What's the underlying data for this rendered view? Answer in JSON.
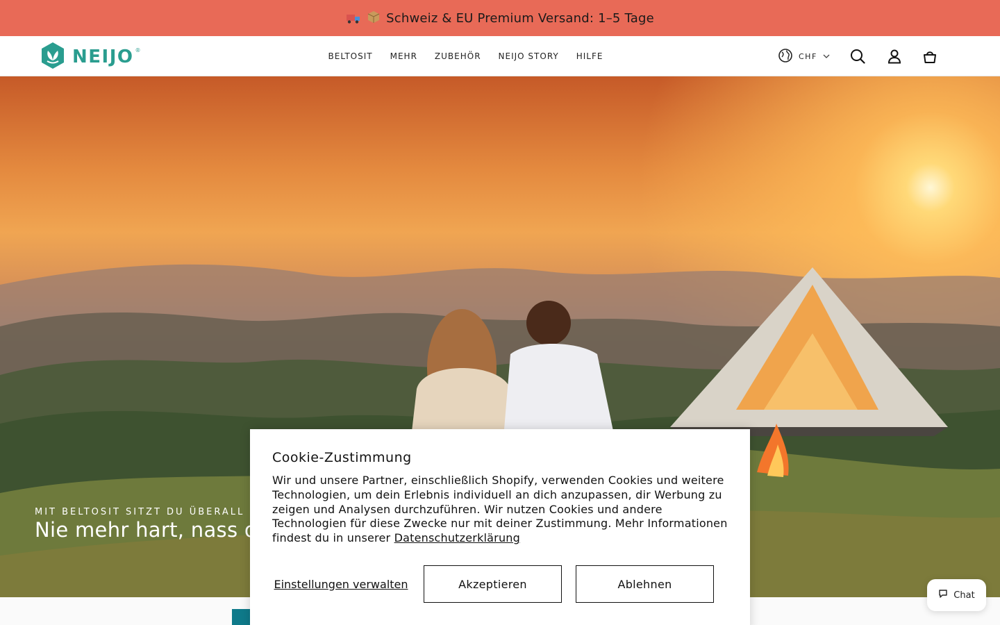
{
  "announcement": {
    "text": "Schweiz & EU Premium Versand: 1–5 Tage"
  },
  "header": {
    "logo_text": "NEIJO",
    "logo_mark": "®",
    "nav": [
      "BELTOSIT",
      "MEHR",
      "ZUBEHÖR",
      "NEIJO STORY",
      "HILFE"
    ],
    "currency": "CHF",
    "icons": [
      "globe-icon",
      "chevron-down-icon",
      "search-icon",
      "account-icon",
      "cart-icon"
    ]
  },
  "hero": {
    "subtitle": "MIT BELTOSIT SITZT DU ÜBERALL BEQU",
    "title": "Nie mehr hart, nass ode"
  },
  "cookie": {
    "title": "Cookie-Zustimmung",
    "body": "Wir und unsere Partner, einschließlich Shopify, verwenden Cookies und weitere Technologien, um dein Erlebnis individuell an dich anzupassen, dir Werbung zu zeigen und Analysen durchzuführen. Wir nutzen Cookies und andere Technologien für diese Zwecke nur mit deiner Zustimmung. Mehr Informationen findest du in unserer",
    "link": "Datenschutzerklärung",
    "manage": "Einstellungen verwalten",
    "accept": "Akzeptieren",
    "decline": "Ablehnen"
  },
  "chat": {
    "label": "Chat"
  },
  "colors": {
    "announcement_bg": "#e86a57",
    "brand": "#2a9d8f"
  }
}
